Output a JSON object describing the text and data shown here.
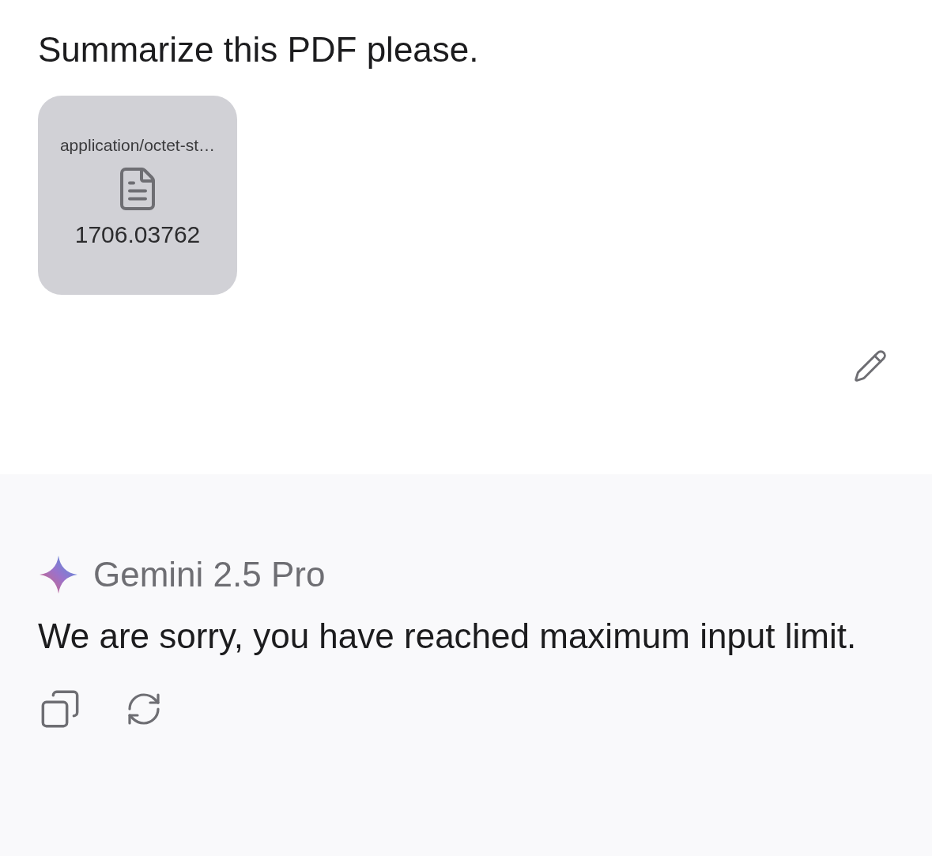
{
  "user_message": {
    "text": "Summarize this PDF please.",
    "attachment": {
      "type_label": "application/octet-st…",
      "filename": "1706.03762"
    }
  },
  "response": {
    "model": "Gemini 2.5 Pro",
    "text": "We are sorry, you have reached maximum input limit."
  }
}
